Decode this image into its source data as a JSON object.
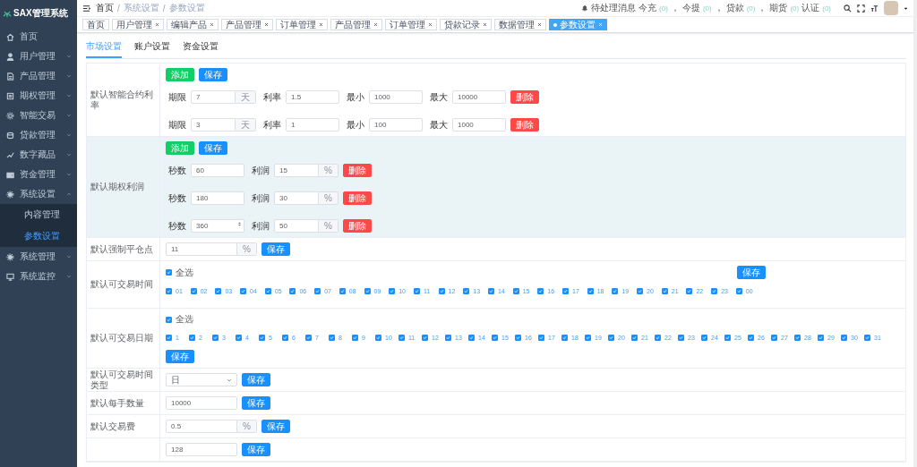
{
  "app": {
    "title": "SAX管理系统"
  },
  "sidebar": {
    "items": [
      {
        "label": "首页",
        "kind": "link"
      },
      {
        "label": "用户管理",
        "kind": "group",
        "expanded": false
      },
      {
        "label": "产品管理",
        "kind": "group",
        "expanded": false
      },
      {
        "label": "期权管理",
        "kind": "group",
        "expanded": false
      },
      {
        "label": "智能交易",
        "kind": "group",
        "expanded": false
      },
      {
        "label": "贷款管理",
        "kind": "group",
        "expanded": false
      },
      {
        "label": "数字藏品",
        "kind": "group",
        "expanded": false
      },
      {
        "label": "资金管理",
        "kind": "group",
        "expanded": false
      },
      {
        "label": "系统设置",
        "kind": "group",
        "expanded": true,
        "children": [
          {
            "label": "内容管理",
            "selected": false
          },
          {
            "label": "参数设置",
            "selected": true
          }
        ]
      },
      {
        "label": "系统管理",
        "kind": "group",
        "expanded": false
      },
      {
        "label": "系统监控",
        "kind": "group",
        "expanded": false
      }
    ]
  },
  "breadcrumb": {
    "separator": "/",
    "items": [
      "首页",
      "系统设置",
      "参数设置"
    ]
  },
  "notifications": {
    "label": "待处理消息",
    "counters": [
      {
        "label": "今充",
        "count": "(0)",
        "separator": "，"
      },
      {
        "label": "今提",
        "count": "(0)",
        "separator": "，"
      },
      {
        "label": "贷款",
        "count": "(0)",
        "separator": "，"
      },
      {
        "label": "期货",
        "count": "(0)"
      },
      {
        "label": "认证",
        "count": "(0)"
      }
    ]
  },
  "tags": [
    {
      "label": "首页",
      "closable": false,
      "selected": false
    },
    {
      "label": "用户管理",
      "closable": true,
      "selected": false
    },
    {
      "label": "编辑产品",
      "closable": true,
      "selected": false
    },
    {
      "label": "产品管理",
      "closable": true,
      "selected": false
    },
    {
      "label": "订单管理",
      "closable": true,
      "selected": false
    },
    {
      "label": "产品管理",
      "closable": true,
      "selected": false
    },
    {
      "label": "订单管理",
      "closable": true,
      "selected": false
    },
    {
      "label": "贷款记录",
      "closable": true,
      "selected": false
    },
    {
      "label": "数据管理",
      "closable": true,
      "selected": false
    },
    {
      "label": "参数设置",
      "closable": true,
      "selected": true
    }
  ],
  "tabs": [
    {
      "label": "市场设置",
      "selected": true
    },
    {
      "label": "账户设置",
      "selected": false
    },
    {
      "label": "资金设置",
      "selected": false
    }
  ],
  "sections": [
    {
      "kind": "row_list",
      "label": "默认智能合约利率",
      "highlighted": false,
      "buttons": [
        {
          "label": "添加",
          "kind": "add"
        },
        {
          "label": "保存",
          "kind": "save"
        }
      ],
      "rows": [
        {
          "fields": [
            {
              "label": "期限",
              "value": "7",
              "unit": "天"
            },
            {
              "label": "利率",
              "value": "1.5"
            },
            {
              "label": "最小",
              "value": "1000"
            },
            {
              "label": "最大",
              "value": "10000"
            }
          ],
          "button": "删除"
        },
        {
          "fields": [
            {
              "label": "期限",
              "value": "3",
              "unit": "天"
            },
            {
              "label": "利率",
              "value": "1"
            },
            {
              "label": "最小",
              "value": "100"
            },
            {
              "label": "最大",
              "value": "1000"
            }
          ],
          "button": "删除"
        }
      ]
    },
    {
      "kind": "row_list",
      "label": "默认期权利润",
      "highlighted": true,
      "buttons": [
        {
          "label": "添加",
          "kind": "add"
        },
        {
          "label": "保存",
          "kind": "save"
        }
      ],
      "rows": [
        {
          "fields": [
            {
              "label": "秒数",
              "value": "60",
              "spinner": false
            },
            {
              "label": "利润",
              "value": "15",
              "unit": "%"
            }
          ],
          "button": "删除"
        },
        {
          "fields": [
            {
              "label": "秒数",
              "value": "180",
              "spinner": false
            },
            {
              "label": "利润",
              "value": "30",
              "unit": "%"
            }
          ],
          "button": "删除"
        },
        {
          "fields": [
            {
              "label": "秒数",
              "value": "360",
              "spinner": true
            },
            {
              "label": "利润",
              "value": "50",
              "unit": "%"
            }
          ],
          "button": "删除"
        }
      ]
    },
    {
      "kind": "input",
      "label": "默认强制平仓点",
      "value": "11",
      "unit": "%",
      "button": "保存"
    },
    {
      "kind": "checkbox_grid",
      "label": "默认可交易时间",
      "save_below": false,
      "all": {
        "label": "全选",
        "checked": true
      },
      "button": "保存",
      "items": [
        {
          "label": "01",
          "checked": true
        },
        {
          "label": "02",
          "checked": true
        },
        {
          "label": "03",
          "checked": true
        },
        {
          "label": "04",
          "checked": true
        },
        {
          "label": "05",
          "checked": true
        },
        {
          "label": "06",
          "checked": true
        },
        {
          "label": "07",
          "checked": true
        },
        {
          "label": "08",
          "checked": true
        },
        {
          "label": "09",
          "checked": true
        },
        {
          "label": "10",
          "checked": true
        },
        {
          "label": "11",
          "checked": true
        },
        {
          "label": "12",
          "checked": true
        },
        {
          "label": "13",
          "checked": true
        },
        {
          "label": "14",
          "checked": true
        },
        {
          "label": "15",
          "checked": true
        },
        {
          "label": "16",
          "checked": true
        },
        {
          "label": "17",
          "checked": true
        },
        {
          "label": "18",
          "checked": true
        },
        {
          "label": "19",
          "checked": true
        },
        {
          "label": "20",
          "checked": true
        },
        {
          "label": "21",
          "checked": true
        },
        {
          "label": "22",
          "checked": true
        },
        {
          "label": "23",
          "checked": true
        },
        {
          "label": "00",
          "checked": true
        }
      ]
    },
    {
      "kind": "checkbox_grid",
      "label": "默认可交易日期",
      "save_below": true,
      "all": {
        "label": "全选",
        "checked": true
      },
      "button": "保存",
      "items": [
        {
          "label": "1",
          "checked": true
        },
        {
          "label": "2",
          "checked": true
        },
        {
          "label": "3",
          "checked": true
        },
        {
          "label": "4",
          "checked": true
        },
        {
          "label": "5",
          "checked": true
        },
        {
          "label": "6",
          "checked": true
        },
        {
          "label": "7",
          "checked": true
        },
        {
          "label": "8",
          "checked": true
        },
        {
          "label": "9",
          "checked": true
        },
        {
          "label": "10",
          "checked": true
        },
        {
          "label": "11",
          "checked": true
        },
        {
          "label": "12",
          "checked": true
        },
        {
          "label": "13",
          "checked": true
        },
        {
          "label": "14",
          "checked": true
        },
        {
          "label": "15",
          "checked": true
        },
        {
          "label": "16",
          "checked": true
        },
        {
          "label": "17",
          "checked": true
        },
        {
          "label": "18",
          "checked": true
        },
        {
          "label": "19",
          "checked": true
        },
        {
          "label": "20",
          "checked": true
        },
        {
          "label": "21",
          "checked": true
        },
        {
          "label": "22",
          "checked": true
        },
        {
          "label": "23",
          "checked": true
        },
        {
          "label": "24",
          "checked": true
        },
        {
          "label": "25",
          "checked": true
        },
        {
          "label": "26",
          "checked": true
        },
        {
          "label": "27",
          "checked": true
        },
        {
          "label": "28",
          "checked": true
        },
        {
          "label": "29",
          "checked": true
        },
        {
          "label": "30",
          "checked": true
        },
        {
          "label": "31",
          "checked": true
        }
      ]
    },
    {
      "kind": "select",
      "label": "默认可交易时间类型",
      "value": "日",
      "button": "保存"
    },
    {
      "kind": "input",
      "label": "默认每手数量",
      "value": "10000",
      "button": "保存"
    },
    {
      "kind": "input",
      "label": "默认交易费",
      "value": "0.5",
      "unit": "%",
      "button": "保存"
    },
    {
      "kind": "input",
      "value": "128",
      "button": "保存"
    }
  ]
}
